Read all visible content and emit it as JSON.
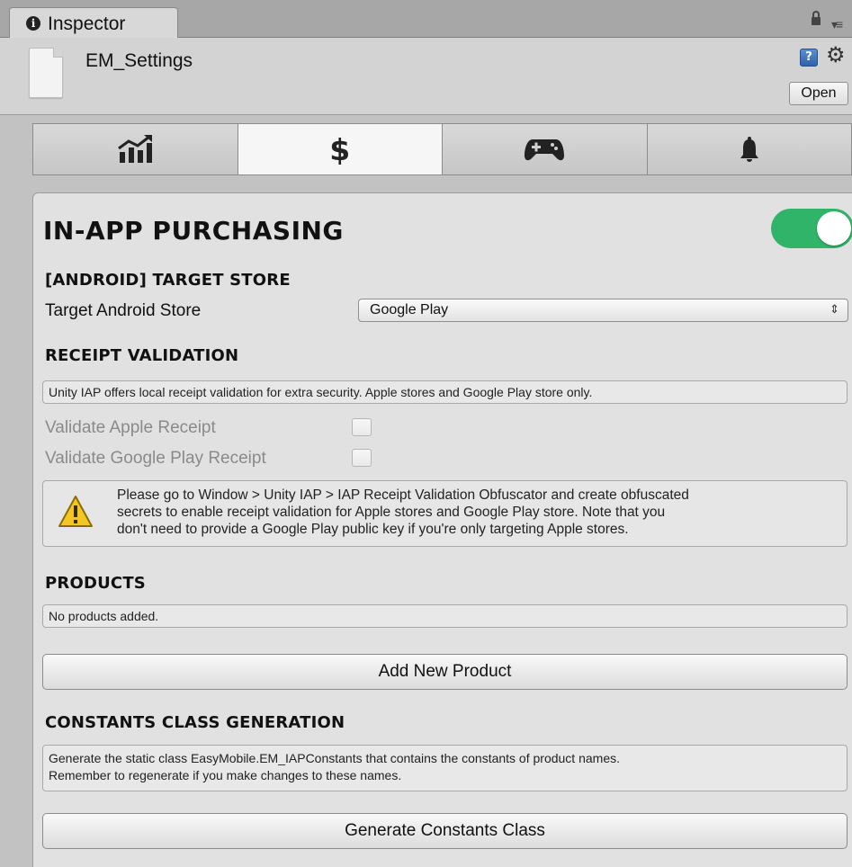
{
  "window": {
    "tab_label": "Inspector",
    "info_glyph": "i"
  },
  "header": {
    "asset_name": "EM_Settings",
    "help_glyph": "?",
    "gear_glyph": "⚙",
    "open_label": "Open"
  },
  "toolbar": {
    "buttons": [
      {
        "icon": "chart-icon",
        "active": false
      },
      {
        "icon": "dollar-icon",
        "glyph": "$",
        "active": true
      },
      {
        "icon": "gamepad-icon",
        "active": false
      },
      {
        "icon": "bell-icon",
        "active": false
      }
    ]
  },
  "module": {
    "title": "IN-APP PURCHASING",
    "enabled": true,
    "toggle_color": "#2fb46a",
    "target_store": {
      "section_title": "[ANDROID] TARGET STORE",
      "field_label": "Target Android Store",
      "selected": "Google Play",
      "arrow": "⇕"
    },
    "receipt_validation": {
      "section_title": "RECEIPT VALIDATION",
      "help": "Unity IAP offers local receipt validation for extra security. Apple stores and Google Play store only.",
      "apple_label": "Validate Apple Receipt",
      "apple_checked": false,
      "google_label": "Validate Google Play Receipt",
      "google_checked": false,
      "warning_lines": [
        "Please go to Window > Unity IAP > IAP Receipt Validation Obfuscator and create obfuscated",
        "secrets to enable receipt validation for Apple stores and Google Play store. Note that you",
        "don't need to provide a Google Play public key if you're only targeting Apple stores."
      ]
    },
    "products": {
      "section_title": "PRODUCTS",
      "empty_text": "No products added.",
      "add_button": "Add New Product"
    },
    "constants": {
      "section_title": "CONSTANTS CLASS GENERATION",
      "help_lines": [
        "Generate the static class EasyMobile.EM_IAPConstants that contains the constants of product names.",
        "Remember to regenerate if you make changes to these names."
      ],
      "generate_button": "Generate Constants Class"
    }
  }
}
